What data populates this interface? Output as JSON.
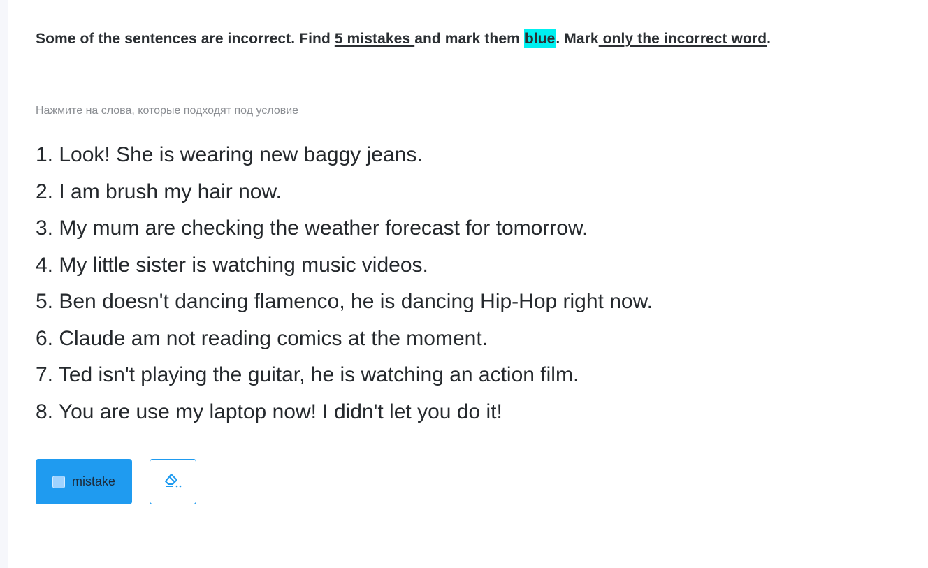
{
  "instruction": {
    "part1": "Some of the sentences are incorrect. Find ",
    "count": "5 mistakes ",
    "part2": "and mark them ",
    "color_word": "blue",
    "part3": ". Mark",
    "only": " only the incorrect word",
    "end": "."
  },
  "hint": "Нажмите на слова, которые подходят под условие",
  "sentences": [
    "1. Look! She is wearing new baggy jeans.",
    "2. I am brush my hair now.",
    "3. My mum are checking the weather forecast for tomorrow.",
    "4. My little sister is watching music videos.",
    "5. Ben doesn't dancing flamenco, he is dancing Hip-Hop right now.",
    "6. Claude am not reading comics at the moment.",
    "7. Ted isn't playing the guitar, he is watching an action film.",
    "8. You are use my laptop now! I didn't let you do it!"
  ],
  "toolbar": {
    "mistake_label": "mistake",
    "eraser_icon": "eraser-icon"
  },
  "colors": {
    "highlight": "#00f0f0",
    "accent": "#1f9bf0",
    "swatch": "#9fd3ff"
  }
}
